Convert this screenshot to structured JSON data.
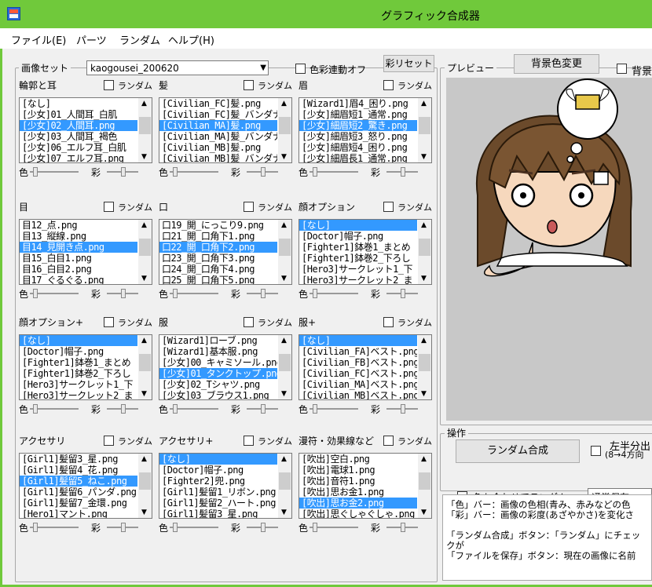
{
  "window": {
    "title": "グラフィック合成器",
    "accent": "#70c93b"
  },
  "menu": [
    "ファイル(E)",
    "パーツ",
    "ランダム",
    "ヘルプ(H)"
  ],
  "image_set": {
    "label": "画像セット",
    "selected": "kaogousei_200620",
    "color_link_label": "色彩連動オフ",
    "color_reset_button": "彩リセット"
  },
  "preview": {
    "label": "プレビュー",
    "bg_change_button": "背景色変更",
    "bg_label": "背景"
  },
  "slider_labels": {
    "color": "色",
    "saturation": "彩"
  },
  "parts": [
    {
      "title": "輪郭と耳",
      "random": "ランダム",
      "items": [
        "[なし]",
        "[少女]01_人間耳_白肌",
        "[少女]02_人間耳.png",
        "[少女]03_人間耳_褐色",
        "[少女]06_エルフ耳_白肌",
        "[少女]07_エルフ耳.png"
      ],
      "selected": 2
    },
    {
      "title": "髪",
      "random": "ランダム",
      "items": [
        "[Civilian_FC]髪.png",
        "[Civilian_FC]髪_バンダナ",
        "[Civilian_MA]髪.png",
        "[Civilian_MA]髪_バンダナ",
        "[Civilian_MB]髪.png",
        "[Civilian_MB]髪_バンダナ"
      ],
      "selected": 2
    },
    {
      "title": "眉",
      "random": "ランダム",
      "items": [
        "[Wizard1]眉4_困り.png",
        "[少女]細眉短1_通常.png",
        "[少女]細眉短2_驚き.png",
        "[少女]細眉短3_怒り.png",
        "[少女]細眉短4_困り.png",
        "[少女]細眉長1_通常.png"
      ],
      "selected": 2
    },
    {
      "title": "目",
      "random": "ランダム",
      "items": [
        "目12_点.png",
        "目13_縦線.png",
        "目14_見開き点.png",
        "目15_白目1.png",
        "目16_白目2.png",
        "目17_ぐるぐる.png"
      ],
      "selected": 2
    },
    {
      "title": "口",
      "random": "ランダム",
      "items": [
        "口19_開_にっこり9.png",
        "口21_開_口角下1.png",
        "口22_開_口角下2.png",
        "口23_開_口角下3.png",
        "口24_開_口角下4.png",
        "口25_開_口角下5.png"
      ],
      "selected": 2
    },
    {
      "title": "顔オプション",
      "random": "ランダム",
      "items": [
        "[なし]",
        "[Doctor]帽子.png",
        "[Fighter1]鉢巻1_まとめ",
        "[Fighter1]鉢巻2_下ろし",
        "[Hero3]サークレット1_下",
        "[Hero3]サークレット2_ま"
      ],
      "selected": 0
    },
    {
      "title": "顔オプション+",
      "random": "ランダム",
      "items": [
        "[なし]",
        "[Doctor]帽子.png",
        "[Fighter1]鉢巻1_まとめ",
        "[Fighter1]鉢巻2_下ろし",
        "[Hero3]サークレット1_下",
        "[Hero3]サークレット2_ま"
      ],
      "selected": 0
    },
    {
      "title": "服",
      "random": "ランダム",
      "items": [
        "[Wizard1]ローブ.png",
        "[Wizard1]基本服.png",
        "[少女]00_キャミソール.png",
        "[少女]01_タンクトップ.png",
        "[少女]02_Tシャツ.png",
        "[少女]03_ブラウス1.png"
      ],
      "selected": 3
    },
    {
      "title": "服+",
      "random": "ランダム",
      "items": [
        "[なし]",
        "[Civilian_FA]ベスト.png",
        "[Civilian_FB]ベスト.png",
        "[Civilian_FC]ベスト.png",
        "[Civilian_MA]ベスト.png",
        "[Civilian_MB]ベスト.png"
      ],
      "selected": 0
    },
    {
      "title": "アクセサリ",
      "random": "ランダム",
      "items": [
        "[Girl1]髪留3_星.png",
        "[Girl1]髪留4_花.png",
        "[Girl1]髪留5_ねこ.png",
        "[Girl1]髪留6_パンダ.png",
        "[Girl1]髪留7_金環.png",
        "[Hero1]マント.png"
      ],
      "selected": 2
    },
    {
      "title": "アクセサリ+",
      "random": "ランダム",
      "items": [
        "[なし]",
        "[Doctor]帽子.png",
        "[Fighter2]兜.png",
        "[Girl1]髪留1_リボン.png",
        "[Girl1]髪留2_ハート.png",
        "[Girl1]髪留3_星.png"
      ],
      "selected": 0
    },
    {
      "title": "漫符・効果線など",
      "random": "ランダム",
      "items": [
        "[吹出]空白.png",
        "[吹出]電球1.png",
        "[吹出]音符1.png",
        "[吹出]思お金1.png",
        "[吹出]思お金2.png",
        "[吹出]思ぐしゃぐしゃ.png"
      ],
      "selected": 4
    }
  ],
  "operations": {
    "label": "操作",
    "random_compose_button": "ランダム合成",
    "half_label": "左半分出",
    "half_sub": "(8→4方向",
    "color_random_label": "色も合わせてランダム",
    "save_mode": "通常保存"
  },
  "help_text": [
    "「色」バー：画像の色相(青み、赤みなどの色",
    "「彩」バー：画像の彩度(あざやかさ)を変化さ",
    "",
    "「ランダム合成」ボタン：「ランダム」にチェックが",
    "「ファイルを保存」ボタン：現在の画像に名前"
  ]
}
